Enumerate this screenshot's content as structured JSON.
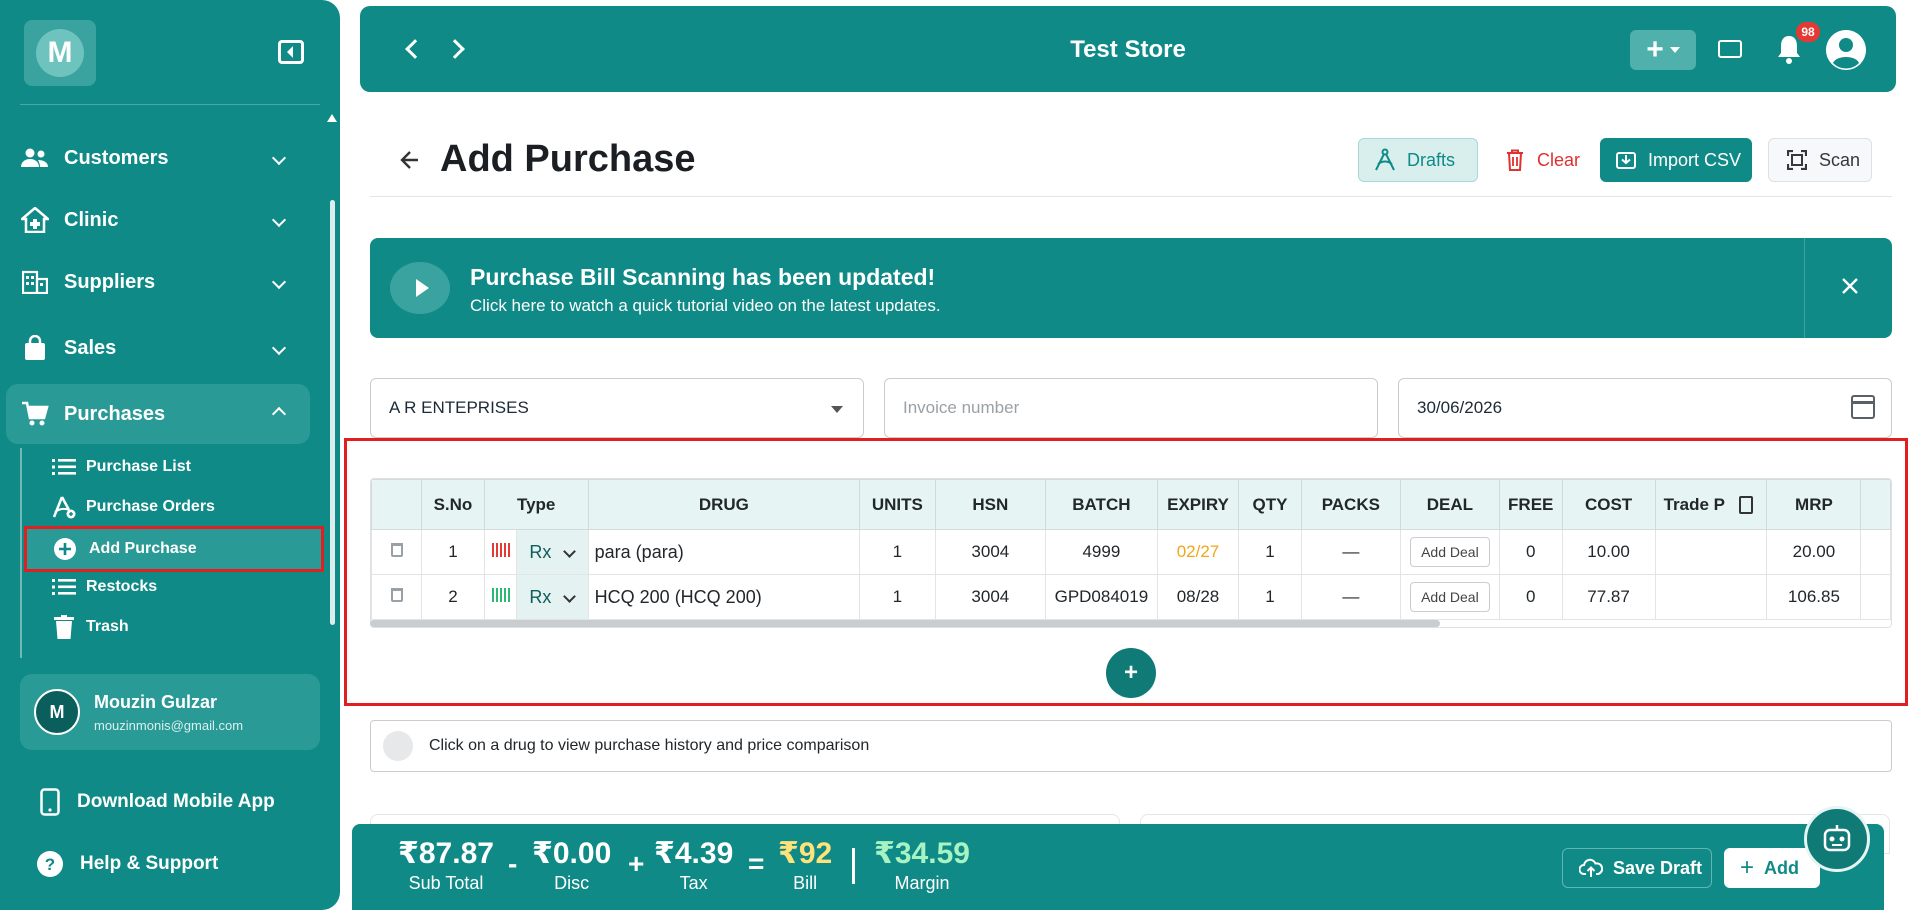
{
  "sidebar": {
    "logo_letter": "M",
    "nav": [
      {
        "label": "Customers"
      },
      {
        "label": "Clinic"
      },
      {
        "label": "Suppliers"
      },
      {
        "label": "Sales"
      },
      {
        "label": "Purchases"
      }
    ],
    "purchases_sub": [
      {
        "label": "Purchase List"
      },
      {
        "label": "Purchase Orders"
      },
      {
        "label": "Add Purchase"
      },
      {
        "label": "Restocks"
      },
      {
        "label": "Trash"
      }
    ],
    "user": {
      "initial": "M",
      "name": "Mouzin Gulzar",
      "email": "mouzinmonis@gmail.com"
    },
    "footer": {
      "download": "Download Mobile App",
      "help": "Help & Support"
    }
  },
  "header": {
    "title": "Test Store",
    "notification_count": "98"
  },
  "page": {
    "title": "Add Purchase",
    "actions": {
      "drafts": "Drafts",
      "clear": "Clear",
      "import": "Import CSV",
      "scan": "Scan"
    }
  },
  "banner": {
    "title": "Purchase Bill Scanning has been updated!",
    "subtitle": "Click here to watch a quick tutorial video on the latest updates."
  },
  "form": {
    "supplier": "A R ENTEPRISES",
    "invoice_placeholder": "Invoice number",
    "date": "30/06/2026"
  },
  "table": {
    "headers": [
      "S.No",
      "Type",
      "DRUG",
      "UNITS",
      "HSN",
      "BATCH",
      "EXPIRY",
      "QTY",
      "PACKS",
      "DEAL",
      "FREE",
      "COST",
      "Trade P",
      "MRP"
    ],
    "rows": [
      {
        "sno": "1",
        "type": "Rx",
        "drug": "para (para)",
        "units": "1",
        "hsn": "3004",
        "batch": "4999",
        "expiry": "02/27",
        "qty": "1",
        "packs": "—",
        "deal": "Add Deal",
        "free": "0",
        "cost": "10.00",
        "trade": "",
        "mrp": "20.00",
        "bar_color": "#e53935"
      },
      {
        "sno": "2",
        "type": "Rx",
        "drug": "HCQ 200 (HCQ 200)",
        "units": "1",
        "hsn": "3004",
        "batch": "GPD084019",
        "expiry": "08/28",
        "qty": "1",
        "packs": "—",
        "deal": "Add Deal",
        "free": "0",
        "cost": "77.87",
        "trade": "",
        "mrp": "106.85",
        "bar_color": "#2eb872"
      }
    ],
    "add_row": "+"
  },
  "info_text": "Click on a drug to view purchase history and price comparison",
  "totals": {
    "subtotal": {
      "value": "₹87.87",
      "label": "Sub Total"
    },
    "disc": {
      "value": "₹0.00",
      "label": "Disc"
    },
    "tax": {
      "value": "₹4.39",
      "label": "Tax"
    },
    "bill": {
      "value": "₹92",
      "label": "Bill"
    },
    "margin": {
      "value": "₹34.59",
      "label": "Margin"
    },
    "ops": {
      "minus": "-",
      "plus": "+",
      "equals": "="
    }
  },
  "bottom_actions": {
    "save_draft": "Save Draft",
    "add": "Add"
  },
  "colors": {
    "primary": "#0f8a86",
    "danger": "#e03030",
    "warning": "#f0a818",
    "highlight": "#e02020"
  }
}
